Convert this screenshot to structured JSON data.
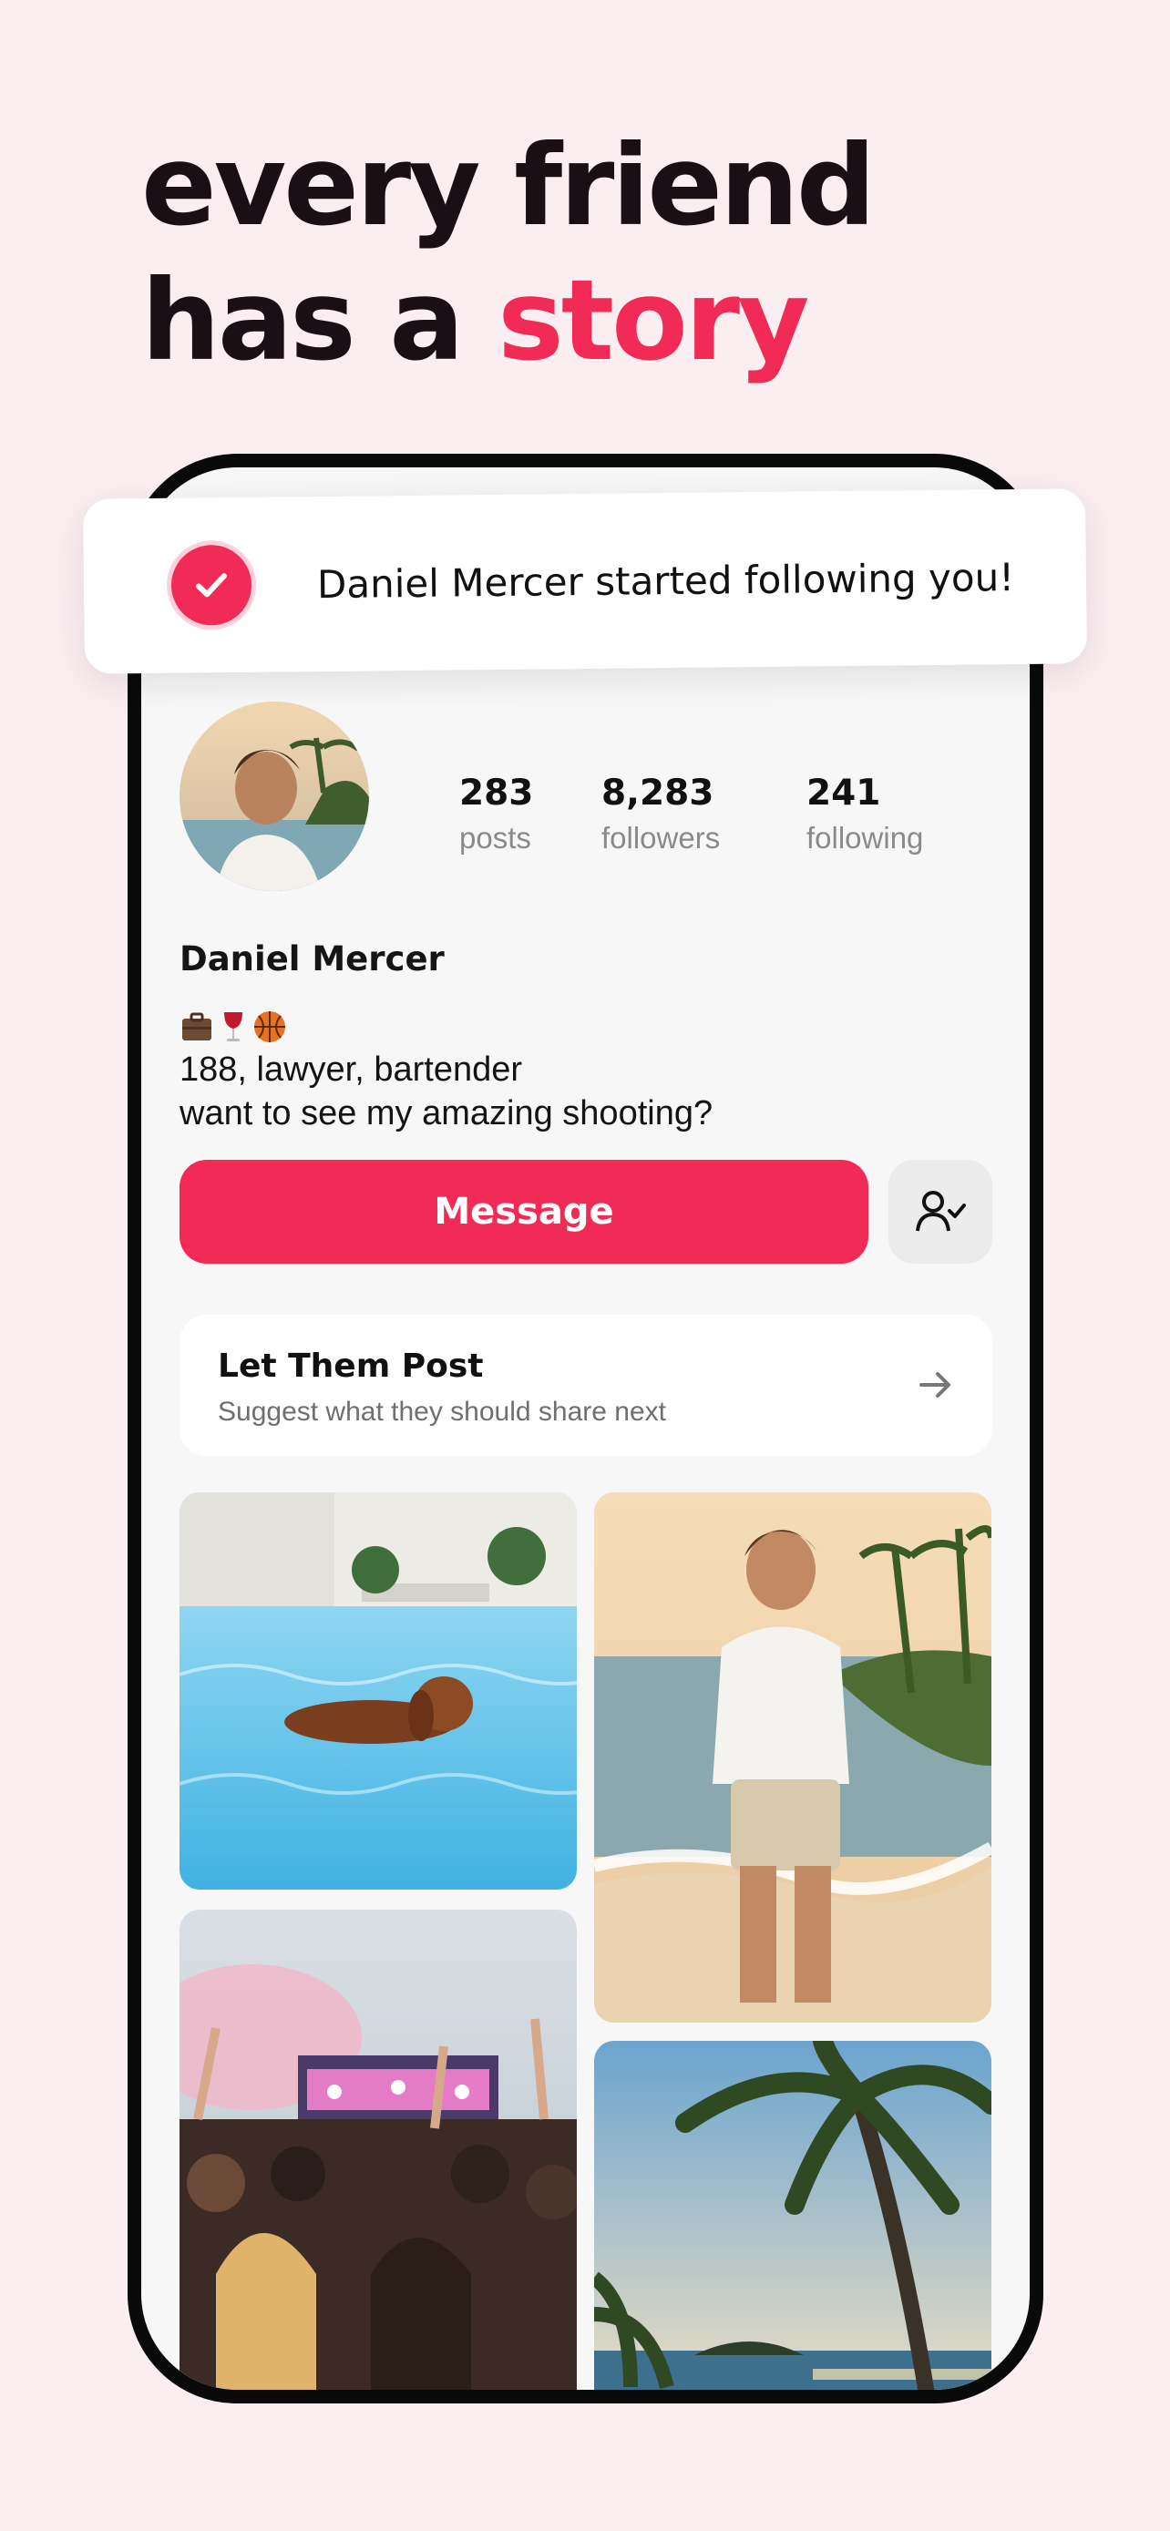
{
  "headline": {
    "line1": "every friend",
    "line2_prefix": "has a ",
    "line2_accent": "story"
  },
  "notification": {
    "text": "Daniel Mercer started following you!",
    "icon": "check-circle-icon"
  },
  "profile": {
    "name": "Daniel Mercer",
    "stats": [
      {
        "value": "283",
        "label": "posts"
      },
      {
        "value": "8,283",
        "label": "followers"
      },
      {
        "value": "241",
        "label": "following"
      }
    ],
    "bio_emojis": [
      "briefcase-icon",
      "wine-glass-icon",
      "basketball-icon"
    ],
    "bio_lines": [
      "188, lawyer, bartender",
      "want to see my amazing shooting?"
    ]
  },
  "actions": {
    "message_label": "Message",
    "follow_icon": "user-check-icon"
  },
  "suggest_card": {
    "title": "Let Them Post",
    "subtitle": "Suggest what they should share next"
  },
  "photos": [
    {
      "subject": "dog-in-pool"
    },
    {
      "subject": "man-on-beach"
    },
    {
      "subject": "concert-crowd"
    },
    {
      "subject": "palm-tree-island"
    }
  ],
  "colors": {
    "accent": "#f22b56",
    "background": "#fbeef1"
  }
}
